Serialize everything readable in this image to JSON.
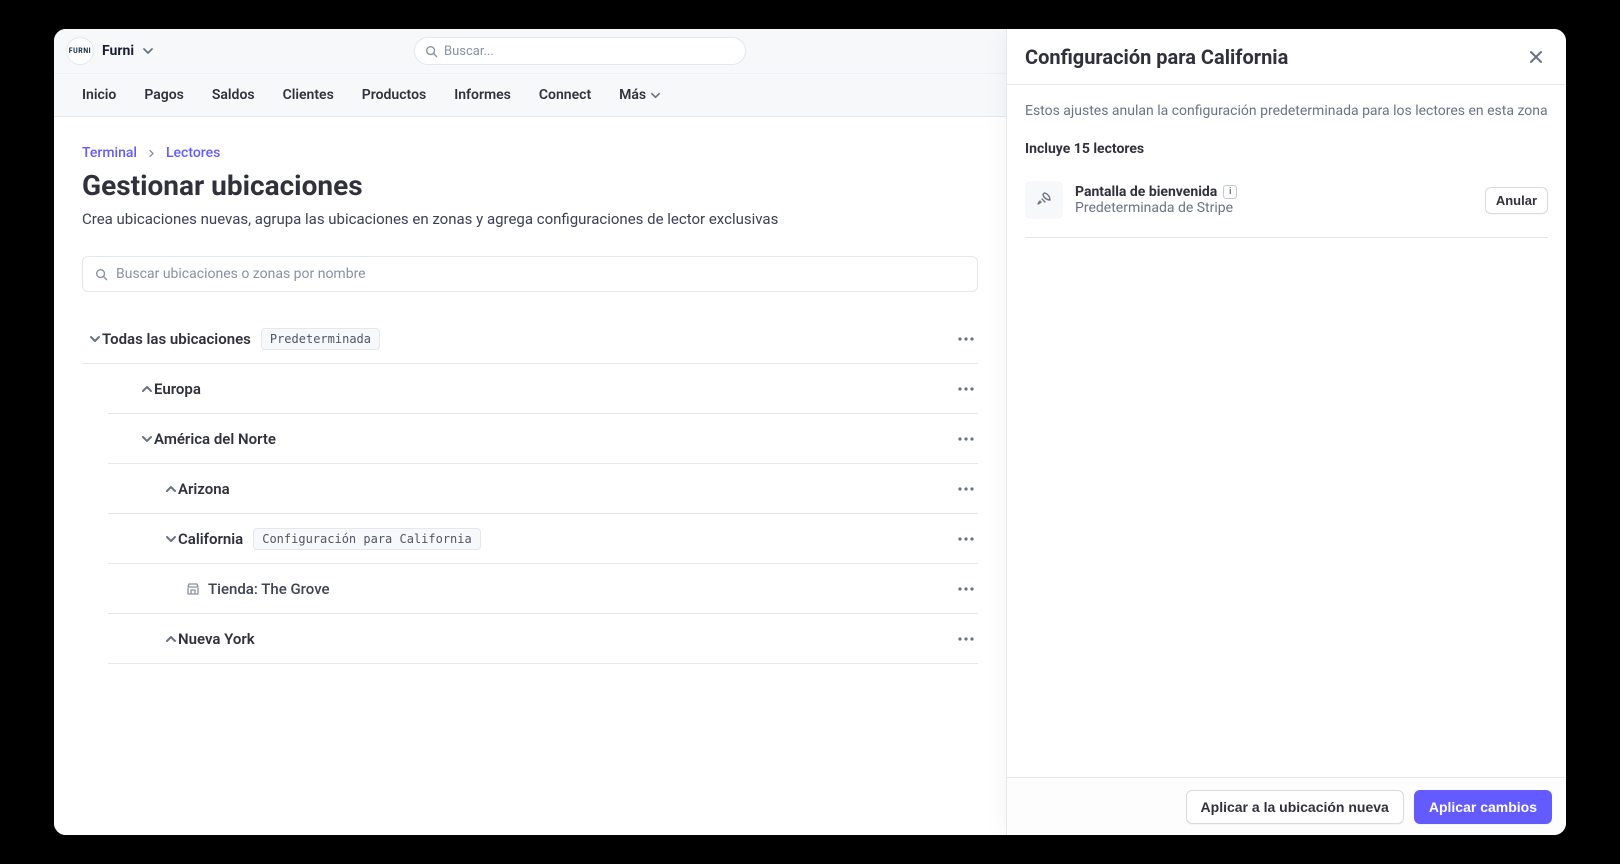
{
  "brand": {
    "logo_text": "FURNI",
    "name": "Furni"
  },
  "search": {
    "placeholder": "Buscar..."
  },
  "nav": {
    "items": [
      "Inicio",
      "Pagos",
      "Saldos",
      "Clientes",
      "Productos",
      "Informes",
      "Connect"
    ],
    "more": "Más"
  },
  "breadcrumbs": {
    "a": "Terminal",
    "b": "Lectores"
  },
  "page": {
    "title": "Gestionar ubicaciones",
    "subtitle": "Crea ubicaciones nuevas, agrupa las ubicaciones en zonas y agrega configuraciones de lector exclusivas"
  },
  "filter": {
    "placeholder": "Buscar ubicaciones o zonas por nombre"
  },
  "tree": {
    "all": {
      "label": "Todas las ubicaciones",
      "badge": "Predeterminada"
    },
    "europe": "Europa",
    "na": "América del Norte",
    "arizona": "Arizona",
    "california": {
      "label": "California",
      "badge": "Configuración para California"
    },
    "grove": "Tienda: The Grove",
    "ny": "Nueva York"
  },
  "panel": {
    "title": "Configuración para California",
    "desc": "Estos ajustes anulan la configuración predeterminada para los lectores en esta zona",
    "subtitle": "Incluye 15 lectores",
    "setting": {
      "title": "Pantalla de bienvenida",
      "sub": "Predeterminada de Stripe"
    },
    "override": "Anular",
    "apply_new": "Aplicar a la ubicación nueva",
    "apply": "Aplicar cambios"
  }
}
